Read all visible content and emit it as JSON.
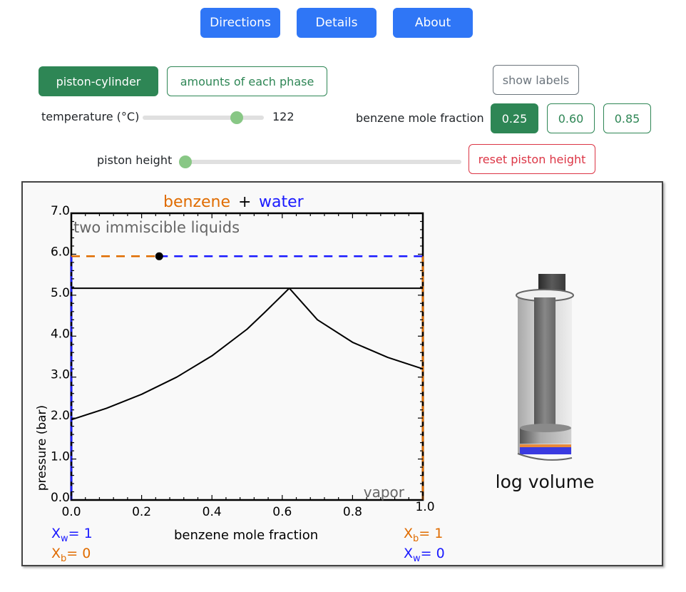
{
  "nav": {
    "directions_label": "Directions",
    "details_label": "Details",
    "about_label": "About"
  },
  "view_toggle": {
    "piston_cylinder_label": "piston-cylinder",
    "amounts_label": "amounts of each phase",
    "active": "piston-cylinder"
  },
  "show_labels_label": "show labels",
  "temperature": {
    "label": "temperature (°C)",
    "value": "122",
    "slider_fraction": 0.81
  },
  "mole_fraction": {
    "label": "benzene mole fraction",
    "options": [
      "0.25",
      "0.60",
      "0.85"
    ],
    "selected": "0.25"
  },
  "piston_height": {
    "label": "piston height",
    "slider_fraction": 0.0,
    "reset_label": "reset piston height"
  },
  "colors": {
    "primary_blue": "#2f76f6",
    "green": "#2e8655",
    "red": "#dc3545",
    "benzene_orange": "#e06c00",
    "water_blue": "#1a1aff",
    "slider_thumb": "#88c785"
  },
  "chart_data": {
    "type": "line",
    "title_parts": [
      {
        "text": "benzene",
        "color": "#e06c00"
      },
      {
        "text": "+",
        "color": "#000000"
      },
      {
        "text": "water",
        "color": "#1a1aff"
      }
    ],
    "xlabel": "benzene mole fraction",
    "ylabel": "pressure (bar)",
    "xlim": [
      0.0,
      1.0
    ],
    "ylim": [
      0.0,
      7.0
    ],
    "xticks": [
      "0.0",
      "0.2",
      "0.4",
      "0.6",
      "0.8",
      "1.0"
    ],
    "yticks": [
      "0.0",
      "1.0",
      "2.0",
      "3.0",
      "4.0",
      "5.0",
      "6.0",
      "7.0"
    ],
    "region_labels": {
      "top": "two immiscible liquids",
      "bottom": "vapor"
    },
    "three_phase_pressure": 5.17,
    "dew_curve_left": {
      "x": [
        0.0,
        0.1,
        0.2,
        0.3,
        0.4,
        0.5,
        0.55,
        0.6,
        0.62
      ],
      "y": [
        1.96,
        2.24,
        2.58,
        3.0,
        3.52,
        4.17,
        4.58,
        5.0,
        5.17
      ]
    },
    "dew_curve_right": {
      "x": [
        0.62,
        0.7,
        0.8,
        0.9,
        1.0
      ],
      "y": [
        5.17,
        4.4,
        3.85,
        3.48,
        3.2
      ]
    },
    "state_point": {
      "x": 0.25,
      "y": 5.95
    },
    "system_pressure_line": {
      "y": 5.95,
      "left_segment_color": "#e06c00",
      "right_segment_color": "#1a1aff"
    },
    "left_axis_annotations": [
      {
        "var": "X",
        "sub": "w",
        "value": "= 1",
        "color": "#1a1aff"
      },
      {
        "var": "X",
        "sub": "b",
        "value": "= 0",
        "color": "#e06c00"
      }
    ],
    "right_axis_annotations": [
      {
        "var": "X",
        "sub": "b",
        "value": "= 1",
        "color": "#e06c00"
      },
      {
        "var": "X",
        "sub": "w",
        "value": "= 0",
        "color": "#1a1aff"
      }
    ]
  },
  "cylinder": {
    "caption": "log volume",
    "layers": [
      {
        "name": "benzene",
        "color": "#e8893a"
      },
      {
        "name": "water",
        "color": "#3a3ae0"
      }
    ]
  }
}
